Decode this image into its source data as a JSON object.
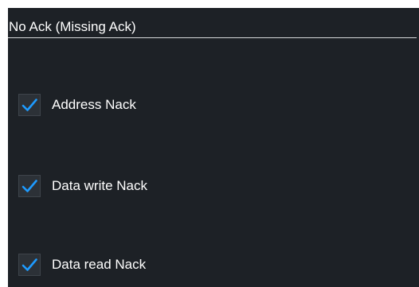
{
  "section": {
    "title": "No Ack (Missing Ack)"
  },
  "checkboxes": [
    {
      "label": "Address Nack",
      "checked": true
    },
    {
      "label": "Data write Nack",
      "checked": true
    },
    {
      "label": "Data read Nack",
      "checked": true
    }
  ],
  "colors": {
    "background": "#1d2126",
    "text": "#ffffff",
    "checkmark": "#1e9bff",
    "divider": "#d8dadc"
  },
  "icons": {
    "checkmark": "check-icon"
  }
}
